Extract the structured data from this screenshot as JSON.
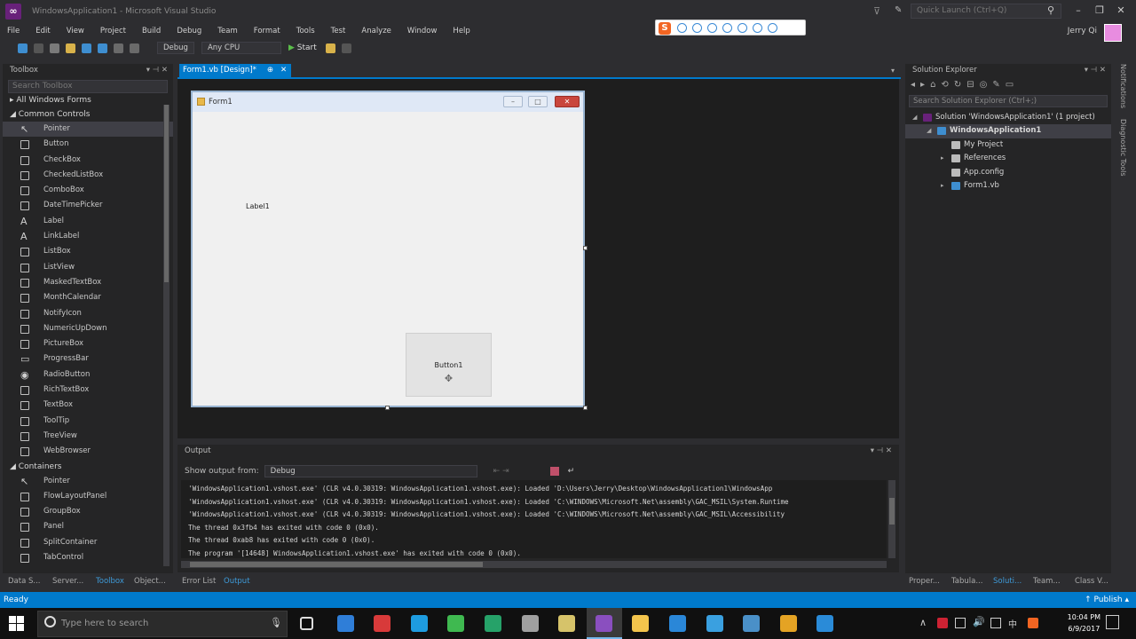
{
  "window": {
    "title": "WindowsApplication1 - Microsoft Visual Studio",
    "quick_launch": "Quick Launch (Ctrl+Q)",
    "user": "Jerry Qi",
    "accent": "#007acc"
  },
  "menu": [
    "File",
    "Edit",
    "View",
    "Project",
    "Build",
    "Debug",
    "Team",
    "Format",
    "Tools",
    "Test",
    "Analyze",
    "Window",
    "Help"
  ],
  "toolbar": {
    "config": "Debug",
    "platform": "Any CPU",
    "start_label": "Start",
    "start_icon": "play-icon"
  },
  "toolbox": {
    "title": "Toolbox",
    "search_placeholder": "Search Toolbox",
    "groups": [
      {
        "label": "All Windows Forms",
        "expanded": false
      },
      {
        "label": "Common Controls",
        "expanded": true
      }
    ],
    "common_controls": [
      "Pointer",
      "Button",
      "CheckBox",
      "CheckedListBox",
      "ComboBox",
      "DateTimePicker",
      "Label",
      "LinkLabel",
      "ListBox",
      "ListView",
      "MaskedTextBox",
      "MonthCalendar",
      "NotifyIcon",
      "NumericUpDown",
      "PictureBox",
      "ProgressBar",
      "RadioButton",
      "RichTextBox",
      "TextBox",
      "ToolTip",
      "TreeView",
      "WebBrowser"
    ],
    "containers_label": "Containers",
    "containers": [
      "Pointer",
      "FlowLayoutPanel",
      "GroupBox",
      "Panel",
      "SplitContainer",
      "TabControl"
    ]
  },
  "doc_tab": {
    "label": "Form1.vb [Design]*",
    "pin": "⊕",
    "close": "✕"
  },
  "form": {
    "title": "Form1",
    "label1": "Label1",
    "button1": "Button1"
  },
  "output": {
    "title": "Output",
    "show_output_from_label": "Show output from:",
    "show_output_from_value": "Debug",
    "lines": [
      "'WindowsApplication1.vshost.exe' (CLR v4.0.30319: WindowsApplication1.vshost.exe): Loaded 'D:\\Users\\Jerry\\Desktop\\WindowsApplication1\\WindowsApp",
      "'WindowsApplication1.vshost.exe' (CLR v4.0.30319: WindowsApplication1.vshost.exe): Loaded 'C:\\WINDOWS\\Microsoft.Net\\assembly\\GAC_MSIL\\System.Runtime",
      "'WindowsApplication1.vshost.exe' (CLR v4.0.30319: WindowsApplication1.vshost.exe): Loaded 'C:\\WINDOWS\\Microsoft.Net\\assembly\\GAC_MSIL\\Accessibility",
      "The thread 0x3fb4 has exited with code 0 (0x0).",
      "The thread 0xab8 has exited with code 0 (0x0).",
      "The program '[14648] WindowsApplication1.vshost.exe' has exited with code 0 (0x0)."
    ]
  },
  "bottom_tabs_left": [
    "Data S...",
    "Server...",
    "Toolbox",
    "Object..."
  ],
  "bottom_tabs_center": [
    "Error List",
    "Output"
  ],
  "bottom_tabs_right": [
    "Proper...",
    "Tabula...",
    "Soluti...",
    "Team...",
    "Class V..."
  ],
  "solution_explorer": {
    "title": "Solution Explorer",
    "search_placeholder": "Search Solution Explorer (Ctrl+;)",
    "items": [
      {
        "label": "Solution 'WindowsApplication1' (1 project)",
        "indent": 0
      },
      {
        "label": "WindowsApplication1",
        "indent": 1,
        "selected": true
      },
      {
        "label": "My Project",
        "indent": 2
      },
      {
        "label": "References",
        "indent": 2
      },
      {
        "label": "App.config",
        "indent": 2
      },
      {
        "label": "Form1.vb",
        "indent": 2
      }
    ]
  },
  "side_tabs": [
    "Notifications",
    "Diagnostic Tools"
  ],
  "status": {
    "left": "Ready",
    "right": "↑ Publish ▴"
  },
  "taskbar": {
    "search_placeholder": "Type here to search",
    "time": "10:04 PM",
    "date": "6/9/2017",
    "apps": [
      {
        "name": "task-view-icon",
        "color": "#101010"
      },
      {
        "name": "app-blue-icon",
        "color": "#2f7ed8"
      },
      {
        "name": "app-red-icon",
        "color": "#d83a3a"
      },
      {
        "name": "app-bluebird-icon",
        "color": "#1e9ce0"
      },
      {
        "name": "wechat-icon",
        "color": "#3fb950"
      },
      {
        "name": "app-green-icon",
        "color": "#26a269"
      },
      {
        "name": "app-files-icon",
        "color": "#a0a0a0"
      },
      {
        "name": "app-tools-icon",
        "color": "#d6c36a"
      },
      {
        "name": "visual-studio-icon",
        "color": "#8a4fbf"
      },
      {
        "name": "file-explorer-icon",
        "color": "#f3c44c"
      },
      {
        "name": "edge-icon",
        "color": "#2a87d8"
      },
      {
        "name": "ie-icon",
        "color": "#3aa0e0"
      },
      {
        "name": "app-globe-icon",
        "color": "#4a90c8"
      },
      {
        "name": "chrome-icon",
        "color": "#e4a324"
      },
      {
        "name": "app-check-icon",
        "color": "#2a8bd8"
      }
    ]
  }
}
